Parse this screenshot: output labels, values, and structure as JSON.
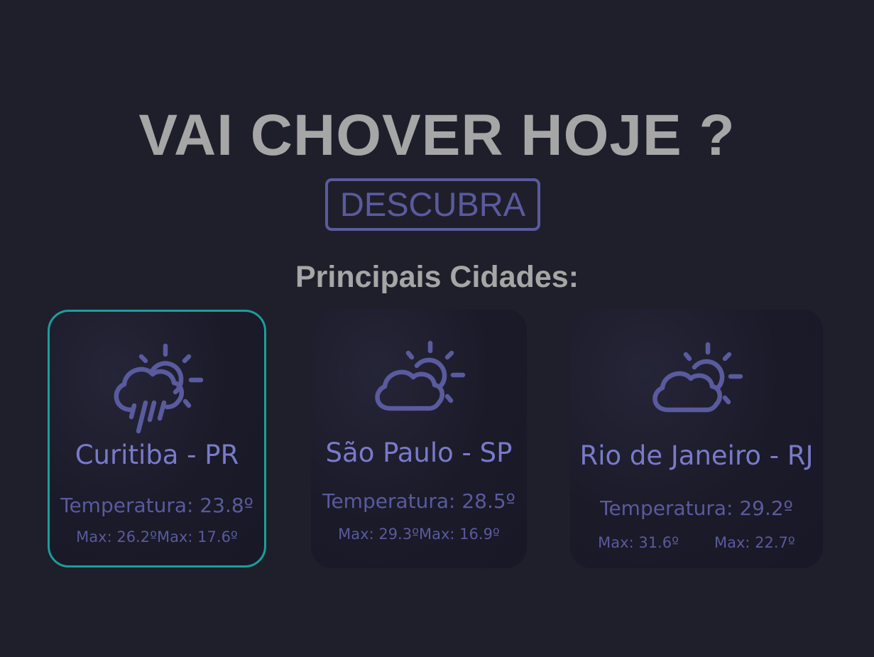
{
  "header": {
    "title": "VAI CHOVER HOJE ?",
    "cta_label": "DESCUBRA"
  },
  "section": {
    "title": "Principais Cidades:"
  },
  "cities": [
    {
      "name": "Curitiba - PR",
      "temperature": "Temperatura: 23.8º",
      "max": "Max: 26.2º",
      "min": "Max: 17.6º",
      "icon": "rain-sun-cloud-icon",
      "selected": true
    },
    {
      "name": "São Paulo - SP",
      "temperature": "Temperatura: 28.5º",
      "max": "Max: 29.3º",
      "min": "Max: 16.9º",
      "icon": "partly-cloudy-icon",
      "selected": false
    },
    {
      "name": "Rio de Janeiro - RJ",
      "temperature": "Temperatura: 29.2º",
      "max": "Max: 31.6º",
      "min": "Max: 22.7º",
      "icon": "partly-cloudy-icon",
      "selected": false
    }
  ],
  "colors": {
    "background": "#1f1f2b",
    "heading": "#a6a6a6",
    "accent": "#5a5a9e",
    "city_name": "#7a7acb",
    "selected_border": "#1b9e9c"
  }
}
